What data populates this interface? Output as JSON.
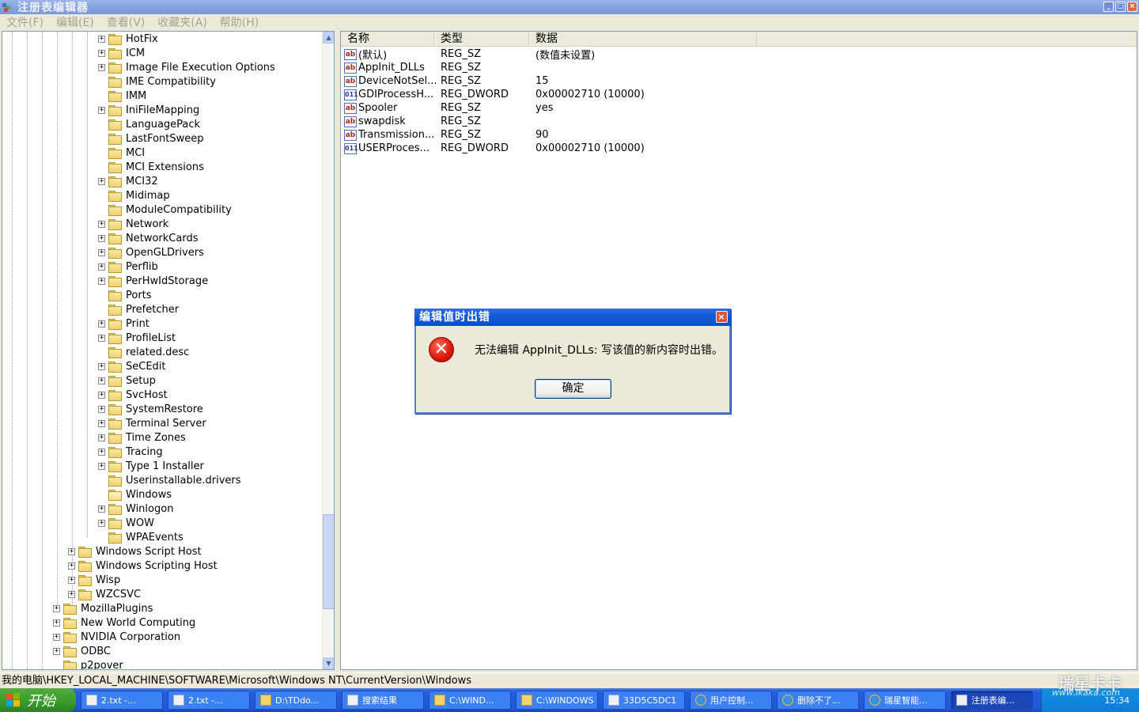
{
  "window": {
    "title": "注册表编辑器"
  },
  "menu": [
    "文件(F)",
    "编辑(E)",
    "查看(V)",
    "收藏夹(A)",
    "帮助(H)"
  ],
  "tree": [
    {
      "label": "HotFix",
      "level": 3,
      "exp": "+"
    },
    {
      "label": "ICM",
      "level": 3,
      "exp": "+"
    },
    {
      "label": "Image File Execution Options",
      "level": 3,
      "exp": "+"
    },
    {
      "label": "IME Compatibility",
      "level": 3,
      "exp": ""
    },
    {
      "label": "IMM",
      "level": 3,
      "exp": ""
    },
    {
      "label": "IniFileMapping",
      "level": 3,
      "exp": "+"
    },
    {
      "label": "LanguagePack",
      "level": 3,
      "exp": ""
    },
    {
      "label": "LastFontSweep",
      "level": 3,
      "exp": ""
    },
    {
      "label": "MCI",
      "level": 3,
      "exp": ""
    },
    {
      "label": "MCI Extensions",
      "level": 3,
      "exp": ""
    },
    {
      "label": "MCI32",
      "level": 3,
      "exp": "+"
    },
    {
      "label": "Midimap",
      "level": 3,
      "exp": ""
    },
    {
      "label": "ModuleCompatibility",
      "level": 3,
      "exp": ""
    },
    {
      "label": "Network",
      "level": 3,
      "exp": "+"
    },
    {
      "label": "NetworkCards",
      "level": 3,
      "exp": "+"
    },
    {
      "label": "OpenGLDrivers",
      "level": 3,
      "exp": "+"
    },
    {
      "label": "Perflib",
      "level": 3,
      "exp": "+"
    },
    {
      "label": "PerHwIdStorage",
      "level": 3,
      "exp": "+"
    },
    {
      "label": "Ports",
      "level": 3,
      "exp": ""
    },
    {
      "label": "Prefetcher",
      "level": 3,
      "exp": ""
    },
    {
      "label": "Print",
      "level": 3,
      "exp": "+"
    },
    {
      "label": "ProfileList",
      "level": 3,
      "exp": "+"
    },
    {
      "label": "related.desc",
      "level": 3,
      "exp": ""
    },
    {
      "label": "SeCEdit",
      "level": 3,
      "exp": "+"
    },
    {
      "label": "Setup",
      "level": 3,
      "exp": "+"
    },
    {
      "label": "SvcHost",
      "level": 3,
      "exp": "+"
    },
    {
      "label": "SystemRestore",
      "level": 3,
      "exp": "+"
    },
    {
      "label": "Terminal Server",
      "level": 3,
      "exp": "+"
    },
    {
      "label": "Time Zones",
      "level": 3,
      "exp": "+"
    },
    {
      "label": "Tracing",
      "level": 3,
      "exp": "+"
    },
    {
      "label": "Type 1 Installer",
      "level": 3,
      "exp": "+"
    },
    {
      "label": "Userinstallable.drivers",
      "level": 3,
      "exp": ""
    },
    {
      "label": "Windows",
      "level": 3,
      "exp": "",
      "open": true
    },
    {
      "label": "Winlogon",
      "level": 3,
      "exp": "+"
    },
    {
      "label": "WOW",
      "level": 3,
      "exp": "+"
    },
    {
      "label": "WPAEvents",
      "level": 3,
      "exp": ""
    },
    {
      "label": "Windows Script Host",
      "level": 2,
      "exp": "+"
    },
    {
      "label": "Windows Scripting Host",
      "level": 2,
      "exp": "+"
    },
    {
      "label": "Wisp",
      "level": 2,
      "exp": "+"
    },
    {
      "label": "WZCSVC",
      "level": 2,
      "exp": "+"
    },
    {
      "label": "MozillaPlugins",
      "level": 1,
      "exp": "+"
    },
    {
      "label": "New World Computing",
      "level": 1,
      "exp": "+"
    },
    {
      "label": "NVIDIA Corporation",
      "level": 1,
      "exp": "+"
    },
    {
      "label": "ODBC",
      "level": 1,
      "exp": "+"
    },
    {
      "label": "p2pover",
      "level": 1,
      "exp": ""
    }
  ],
  "list": {
    "headers": [
      "名称",
      "类型",
      "数据"
    ],
    "rows": [
      {
        "icon": "ab",
        "name": "(默认)",
        "type": "REG_SZ",
        "data": "(数值未设置)"
      },
      {
        "icon": "ab",
        "name": "AppInit_DLLs",
        "type": "REG_SZ",
        "data": ""
      },
      {
        "icon": "ab",
        "name": "DeviceNotSel...",
        "type": "REG_SZ",
        "data": "15"
      },
      {
        "icon": "bin",
        "name": "GDIProcessH...",
        "type": "REG_DWORD",
        "data": "0x00002710 (10000)"
      },
      {
        "icon": "ab",
        "name": "Spooler",
        "type": "REG_SZ",
        "data": "yes"
      },
      {
        "icon": "ab",
        "name": "swapdisk",
        "type": "REG_SZ",
        "data": ""
      },
      {
        "icon": "ab",
        "name": "Transmission...",
        "type": "REG_SZ",
        "data": "90"
      },
      {
        "icon": "bin",
        "name": "USERProces...",
        "type": "REG_DWORD",
        "data": "0x00002710 (10000)"
      }
    ]
  },
  "status": "我的电脑\\HKEY_LOCAL_MACHINE\\SOFTWARE\\Microsoft\\Windows NT\\CurrentVersion\\Windows",
  "dialog": {
    "title": "编辑值时出错",
    "message": "无法编辑 AppInit_DLLs: 写该值的新内容时出错。",
    "ok": "确定"
  },
  "taskbar": {
    "start": "开始",
    "items": [
      {
        "label": "2.txt -...",
        "icon": "doc"
      },
      {
        "label": "2.txt -...",
        "icon": "doc"
      },
      {
        "label": "D:\\TDdo...",
        "icon": "folder"
      },
      {
        "label": "搜索结果",
        "icon": "doc"
      },
      {
        "label": "C:\\WIND...",
        "icon": "folder"
      },
      {
        "label": "C:\\WINDOWS",
        "icon": "folder"
      },
      {
        "label": "33D5C5DC1",
        "icon": "doc"
      },
      {
        "label": "用户控制...",
        "icon": "ie"
      },
      {
        "label": "删除不了...",
        "icon": "ie"
      },
      {
        "label": "瑞星智能...",
        "icon": "ie"
      },
      {
        "label": "注册表编...",
        "icon": "doc",
        "active": true
      }
    ],
    "clock": "15:34"
  },
  "watermark": {
    "brand": "瑞星卡卡",
    "url": "www.ikaka.com"
  }
}
